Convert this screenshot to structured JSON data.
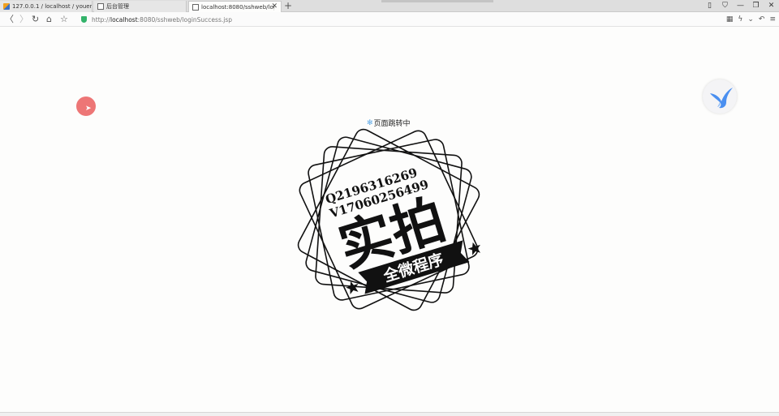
{
  "tabs": [
    {
      "label": "127.0.0.1 / localhost / youery",
      "active": false
    },
    {
      "label": "后台管理",
      "active": false
    },
    {
      "label": "localhost:8080/sshweb/loginS",
      "active": true
    }
  ],
  "address": {
    "scheme": "http://",
    "host": "localhost",
    "rest": ":8080/sshweb/loginSuccess.jsp"
  },
  "redirect_text": "页面跳转中",
  "stamp": {
    "line1": "Q2196316269",
    "line2": "V17060256499",
    "big": "实拍",
    "ribbon": "全微程序"
  },
  "colors": {
    "accent": "#ec6f6f",
    "shield": "#33b36a",
    "bird": "#4a8ff0"
  }
}
